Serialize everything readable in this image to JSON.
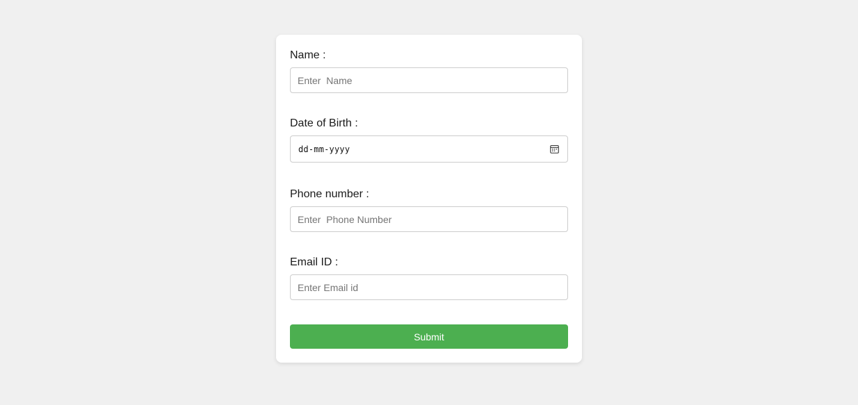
{
  "form": {
    "name": {
      "label": "Name :",
      "placeholder": "Enter  Name",
      "value": ""
    },
    "dob": {
      "label": "Date of Birth :",
      "display": "dd-mm-yyyy",
      "icon": "calendar-icon"
    },
    "phone": {
      "label": "Phone number :",
      "placeholder": "Enter  Phone Number",
      "value": ""
    },
    "email": {
      "label": "Email ID :",
      "placeholder": "Enter Email id",
      "value": ""
    },
    "submit_label": "Submit"
  },
  "colors": {
    "page_background": "#f0f0f0",
    "card_background": "#ffffff",
    "submit_button": "#4caf50",
    "input_border": "#cccccc"
  }
}
